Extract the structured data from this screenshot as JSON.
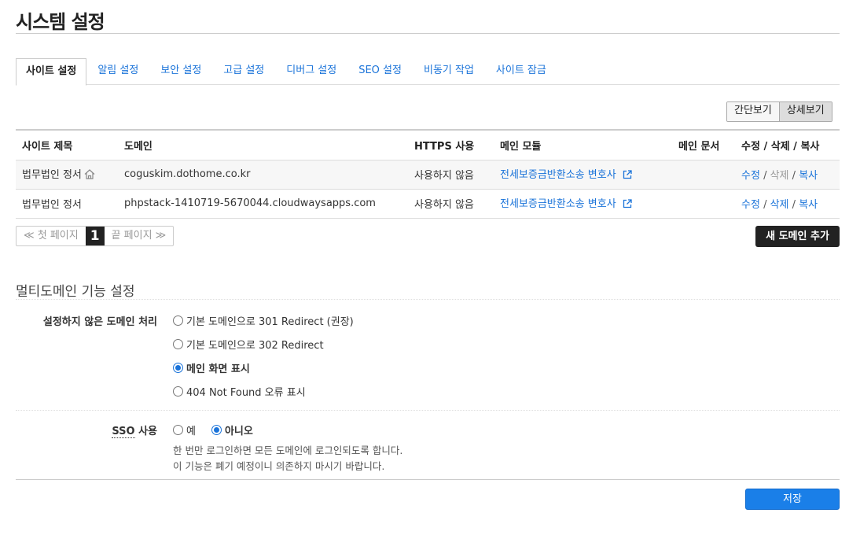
{
  "page": {
    "title": "시스템 설정"
  },
  "tabs": [
    {
      "label": "사이트 설정",
      "active": true
    },
    {
      "label": "알림 설정"
    },
    {
      "label": "보안 설정"
    },
    {
      "label": "고급 설정"
    },
    {
      "label": "디버그 설정"
    },
    {
      "label": "SEO 설정"
    },
    {
      "label": "비동기 작업"
    },
    {
      "label": "사이트 잠금"
    }
  ],
  "view_toggle": {
    "simple": "간단보기",
    "detail": "상세보기"
  },
  "table": {
    "headers": [
      "사이트 제목",
      "도메인",
      "HTTPS 사용",
      "메인 모듈",
      "메인 문서",
      "수정 / 삭제 / 복사"
    ],
    "rows": [
      {
        "title": "법무법인 정서",
        "domain": "coguskim.dothome.co.kr",
        "https": "사용하지 않음",
        "module": "전세보증금반환소송 변호사",
        "document": "",
        "edit": "수정",
        "delete": "삭제",
        "copy": "복사"
      },
      {
        "title": "법무법인 정서",
        "domain": "phpstack-1410719-5670044.cloudwaysapps.com",
        "https": "사용하지 않음",
        "module": "전세보증금반환소송 변호사",
        "document": "",
        "edit": "수정",
        "delete": "삭제",
        "copy": "복사"
      }
    ],
    "separator": "/"
  },
  "pager": {
    "first": "≪ 첫 페이지",
    "current": "1",
    "last": "끝 페이지 ≫"
  },
  "add_domain": "새 도메인 추가",
  "multidomain": {
    "title": "멀티도메인 기능 설정",
    "unset_label": "설정하지 않은 도메인 처리",
    "options": [
      "기본 도메인으로 301 Redirect (권장)",
      "기본 도메인으로 302 Redirect",
      "메인 화면 표시",
      "404 Not Found 오류 표시"
    ],
    "selected": 2,
    "sso_label": "SSO",
    "sso_suffix": " 사용",
    "sso_yes": "예",
    "sso_no": "아니오",
    "sso_help_1": "한 번만 로그인하면 모든 도메인에 로그인되도록 합니다.",
    "sso_help_2": "이 기능은 폐기 예정이니 의존하지 마시기 바랍니다."
  },
  "save": "저장",
  "colors": {
    "link": "#1a73d9",
    "primary_button": "#1a7fe8",
    "dark_button": "#222222"
  }
}
